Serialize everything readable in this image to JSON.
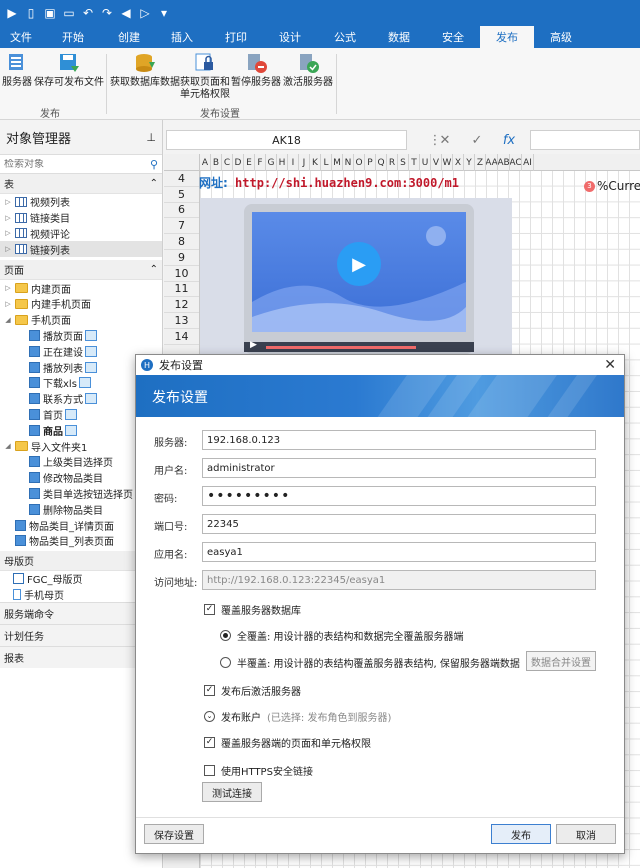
{
  "quick_access": [
    "app-menu-icon",
    "new-icon",
    "save-icon",
    "open-icon",
    "undo-icon",
    "redo-icon",
    "back-icon",
    "forward-icon",
    "customize-icon"
  ],
  "ribbon": {
    "tabs": [
      "文件",
      "开始",
      "创建",
      "插入",
      "打印",
      "设计",
      "公式",
      "数据",
      "安全",
      "发布",
      "高级"
    ],
    "active_tab": "发布",
    "group1": {
      "buttons": [
        "服务器",
        "保存可发布文件"
      ],
      "label": "发布"
    },
    "group2": {
      "buttons": [
        "获取数据库数据",
        "获取页面和\n单元格权限",
        "暂停服务器",
        "激活服务器"
      ],
      "label": "发布设置"
    }
  },
  "object_manager": {
    "title": "对象管理器",
    "search_placeholder": "检索对象",
    "tables_section": "表",
    "tables": [
      "视频列表",
      "链接类目",
      "视频评论",
      "链接列表"
    ],
    "pages_section": "页面",
    "pages": [
      {
        "label": "内建页面",
        "level": 0,
        "type": "folder",
        "tw": "▷"
      },
      {
        "label": "内建手机页面",
        "level": 0,
        "type": "folder",
        "tw": "▷"
      },
      {
        "label": "手机页面",
        "level": 0,
        "type": "folder",
        "tw": "◢"
      },
      {
        "label": "播放页面",
        "level": 1,
        "type": "page",
        "link": true
      },
      {
        "label": "正在建设",
        "level": 1,
        "type": "page",
        "link": true
      },
      {
        "label": "播放列表",
        "level": 1,
        "type": "page",
        "link": true
      },
      {
        "label": "下载xls",
        "level": 1,
        "type": "page",
        "link": true
      },
      {
        "label": "联系方式",
        "level": 1,
        "type": "page",
        "link": true
      },
      {
        "label": "首页",
        "level": 1,
        "type": "page",
        "link": true
      },
      {
        "label": "商品",
        "level": 1,
        "type": "page",
        "link": true,
        "bold": true
      },
      {
        "label": "导入文件夹1",
        "level": 0,
        "type": "folder",
        "tw": "◢"
      },
      {
        "label": "上级类目选择页",
        "level": 1,
        "type": "page"
      },
      {
        "label": "修改物品类目",
        "level": 1,
        "type": "page"
      },
      {
        "label": "类目单选按钮选择页",
        "level": 1,
        "type": "page"
      },
      {
        "label": "删除物品类目",
        "level": 1,
        "type": "page"
      },
      {
        "label": "物品类目_详情页面",
        "level": 0,
        "type": "page"
      },
      {
        "label": "物品类目_列表页面",
        "level": 0,
        "type": "page"
      }
    ],
    "master_section": "母版页",
    "masters": [
      "FGC_母版页",
      "手机母页"
    ],
    "bottom_sections": [
      "服务端命令",
      "计划任务",
      "报表"
    ]
  },
  "formula_bar": {
    "cell_ref": "AK18",
    "fx": "fx"
  },
  "grid": {
    "columns": [
      "A",
      "B",
      "C",
      "D",
      "E",
      "F",
      "G",
      "H",
      "I",
      "J",
      "K",
      "L",
      "M",
      "N",
      "O",
      "P",
      "Q",
      "R",
      "S",
      "T",
      "U",
      "V",
      "W",
      "X",
      "Y",
      "Z",
      "AA",
      "AB",
      "AC",
      "AI"
    ],
    "rows": [
      "4",
      "5",
      "6",
      "7",
      "8",
      "9",
      "10",
      "11",
      "12",
      "13",
      "14"
    ],
    "url_label": "网址:",
    "url_value": "http://shi.huazhen9.com:3000/m1",
    "current_text": "%Current",
    "badge": "3"
  },
  "dialog": {
    "window_title": "发布设置",
    "banner_title": "发布设置",
    "fields": {
      "server_label": "服务器:",
      "server_value": "192.168.0.123",
      "username_label": "用户名:",
      "username_value": "administrator",
      "password_label": "密码:",
      "password_value": "•••••••••",
      "port_label": "端口号:",
      "port_value": "22345",
      "appname_label": "应用名:",
      "appname_value": "easya1",
      "url_label": "访问地址:",
      "url_value": "http://192.168.0.123:22345/easya1"
    },
    "overwrite_db": {
      "label": "覆盖服务器数据库",
      "checked": true
    },
    "full_overwrite": {
      "prefix": "全覆盖",
      "text": ": 用设计器的表结构和数据完全覆盖服务器端",
      "selected": true
    },
    "half_overwrite": {
      "prefix": "半覆盖",
      "text": ": 用设计器的表结构覆盖服务器表结构, 保留服务器端数据",
      "selected": false
    },
    "merge_button": "数据合并设置",
    "activate_after": {
      "label": "发布后激活服务器",
      "checked": true
    },
    "publish_account": {
      "label": "发布账户",
      "hint": "(已选择: 发布角色到服务器)"
    },
    "overwrite_perms": {
      "label": "覆盖服务器端的页面和单元格权限",
      "checked": true
    },
    "https": {
      "label": "使用HTTPS安全链接",
      "checked": false
    },
    "test_button": "测试连接",
    "save_button": "保存设置",
    "publish_button": "发布",
    "cancel_button": "取消"
  }
}
